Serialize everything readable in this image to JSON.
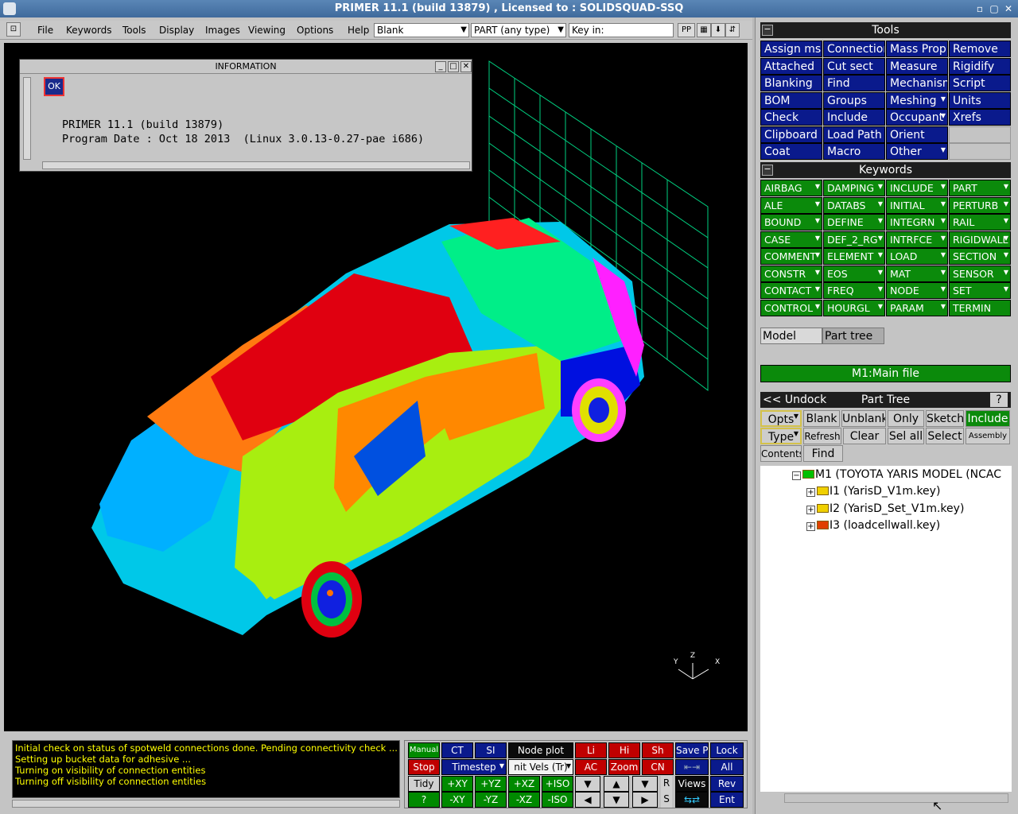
{
  "window": {
    "title": "PRIMER 11.1 (build 13879) , Licensed to : SOLIDSQUAD-SSQ"
  },
  "menu": {
    "items": [
      "File",
      "Keywords",
      "Tools",
      "Display",
      "Images",
      "Viewing",
      "Options",
      "Help"
    ],
    "blank_combo": "Blank",
    "type_combo": "PART  (any type)",
    "key_in": "Key in:",
    "pp_label": "PP"
  },
  "info_dialog": {
    "title": "INFORMATION",
    "ok": "OK",
    "line1": "PRIMER 11.1 (build 13879)",
    "line2": "Program Date : Oct 18 2013  (Linux 3.0.13-0.27-pae i686)"
  },
  "axes": {
    "z": "Z",
    "y": "Y",
    "x": "X"
  },
  "console": {
    "messages": [
      "Initial check on status of spotweld connections done. Pending connectivity check ...",
      "Setting up bucket data for adhesive ...",
      "Turning on visibility of connection entities",
      "Turning off visibility of connection entities"
    ]
  },
  "controls": {
    "manual": "Manual",
    "ct": "CT",
    "si": "SI",
    "node_plot": "Node plot",
    "li": "Li",
    "hi": "Hi",
    "sh": "Sh",
    "save_p": "Save P",
    "lock": "Lock",
    "stop": "Stop",
    "timestep": "Timestep",
    "init_vels": "nit Vels (Tr)",
    "ac": "AC",
    "zoom": "Zoom",
    "cn": "CN",
    "all": "All",
    "tidy": "Tidy",
    "pxy": "+XY",
    "pyz": "+YZ",
    "pxz": "+XZ",
    "piso": "+ISO",
    "r": "R",
    "views": "Views",
    "rev": "Rev",
    "q": "?",
    "mxy": "-XY",
    "myz": "-YZ",
    "mxz": "-XZ",
    "miso": "-ISO",
    "s": "S",
    "ent": "Ent"
  },
  "tools": {
    "header": "Tools",
    "buttons": [
      "Assign ms",
      "Connection",
      "Mass Prop",
      "Remove",
      "Attached",
      "Cut sect",
      "Measure",
      "Rigidify",
      "Blanking",
      "Find",
      "Mechanism",
      "Script",
      "BOM",
      "Groups",
      "Meshing",
      "Units",
      "Check",
      "Include",
      "Occupant",
      "Xrefs",
      "Clipboard",
      "Load Path",
      "Orient",
      "",
      "Coat",
      "Macro",
      "Other",
      ""
    ]
  },
  "keywords": {
    "header": "Keywords",
    "buttons": [
      "AIRBAG",
      "DAMPING",
      "INCLUDE",
      "PART",
      "ALE",
      "DATABS",
      "INITIAL",
      "PERTURB",
      "BOUND",
      "DEFINE",
      "INTEGRN",
      "RAIL",
      "CASE",
      "DEF_2_RG",
      "INTRFCE",
      "RIGIDWALL",
      "COMMENT",
      "ELEMENT",
      "LOAD",
      "SECTION",
      "CONSTR",
      "EOS",
      "MAT",
      "SENSOR",
      "CONTACT",
      "FREQ",
      "NODE",
      "SET",
      "CONTROL",
      "HOURGL",
      "PARAM",
      "TERMIN"
    ]
  },
  "model_tabs": {
    "model": "Model",
    "part_tree": "Part tree"
  },
  "main_file": "M1:Main file",
  "part_tree": {
    "undock": "<< Undock",
    "title": "Part Tree",
    "help": "?",
    "row1": [
      "Opts",
      "Blank",
      "Unblank",
      "Only",
      "Sketch",
      "Include"
    ],
    "row2": [
      "Type",
      "Refresh",
      "Clear",
      "Sel all",
      "Select",
      "Assembly"
    ],
    "row3": [
      "Contents",
      "Find"
    ],
    "root": "M1 (TOYOTA YARIS MODEL (NCAC",
    "children": [
      "I1 (YarisD_V1m.key)",
      "I2 (YarisD_Set_V1m.key)",
      "I3 (loadcellwall.key)"
    ]
  },
  "colors": {
    "tool_blue": "#0a1a8c",
    "keyword_green": "#0b8a0b",
    "console_text": "#ffff00"
  }
}
